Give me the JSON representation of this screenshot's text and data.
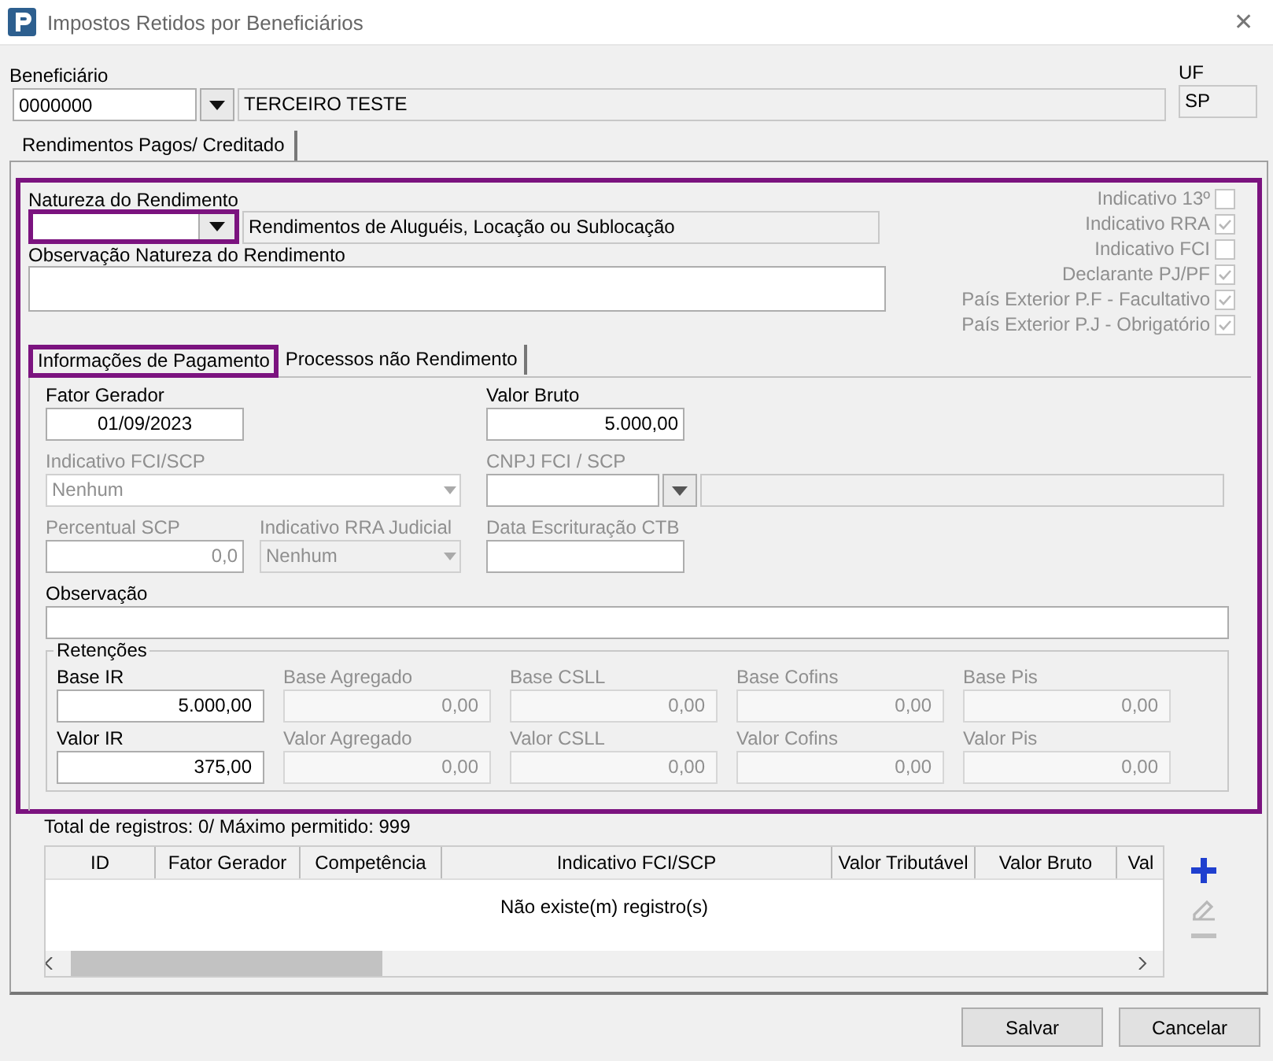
{
  "window": {
    "title": "Impostos Retidos por Beneficiários",
    "close": "✕"
  },
  "beneficiario": {
    "label": "Beneficiário",
    "code": "0000000",
    "name": "TERCEIRO TESTE",
    "uf_label": "UF",
    "uf": "SP"
  },
  "tabs": [
    {
      "label": "Rendimentos Pagos/ Creditado",
      "selected": true
    }
  ],
  "natureza": {
    "label": "Natureza do Rendimento",
    "description": "Rendimentos de Aluguéis, Locação ou Sublocação"
  },
  "observacao_natureza": {
    "label": "Observação Natureza do Rendimento"
  },
  "checkboxes": [
    {
      "label": "Indicativo 13º",
      "checked": false,
      "disabled": true
    },
    {
      "label": "Indicativo RRA",
      "checked": true,
      "disabled": true
    },
    {
      "label": "Indicativo FCI",
      "checked": false,
      "disabled": true
    },
    {
      "label": "Declarante PJ/PF",
      "checked": true,
      "disabled": true
    },
    {
      "label": "País Exterior P.F - Facultativo",
      "checked": true,
      "disabled": true
    },
    {
      "label": "País Exterior P.J - Obrigatório",
      "checked": true,
      "disabled": true
    }
  ],
  "subtabs": [
    {
      "label": "Informações de Pagamento",
      "selected": true
    },
    {
      "label": "Processos não Rendimento",
      "selected": false
    }
  ],
  "payment": {
    "fator_gerador": {
      "label": "Fator Gerador",
      "value": "01/09/2023",
      "disabled": false
    },
    "valor_bruto": {
      "label": "Valor Bruto",
      "value": "5.000,00",
      "disabled": false
    },
    "indicativo_fci": {
      "label": "Indicativo FCI/SCP",
      "value": "Nenhum",
      "disabled": true
    },
    "cnpj_fci": {
      "label": "CNPJ FCI / SCP",
      "disabled": true
    },
    "percentual_scp": {
      "label": "Percentual SCP",
      "value": "0,0",
      "disabled": true
    },
    "indicativo_rra": {
      "label": "Indicativo RRA Judicial",
      "value": "Nenhum",
      "disabled": true
    },
    "data_escrituracao": {
      "label": "Data Escrituração CTB",
      "disabled": true
    },
    "observacao": {
      "label": "Observação",
      "disabled": false
    }
  },
  "retencoes": {
    "title": "Retenções",
    "rows": [
      [
        {
          "label": "Base IR",
          "value": "5.000,00",
          "disabled": false
        },
        {
          "label": "Base Agregado",
          "value": "0,00",
          "disabled": true
        },
        {
          "label": "Base CSLL",
          "value": "0,00",
          "disabled": true
        },
        {
          "label": "Base Cofins",
          "value": "0,00",
          "disabled": true
        },
        {
          "label": "Base Pis",
          "value": "0,00",
          "disabled": true
        }
      ],
      [
        {
          "label": "Valor IR",
          "value": "375,00",
          "disabled": false
        },
        {
          "label": "Valor Agregado",
          "value": "0,00",
          "disabled": true
        },
        {
          "label": "Valor CSLL",
          "value": "0,00",
          "disabled": true
        },
        {
          "label": "Valor Cofins",
          "value": "0,00",
          "disabled": true
        },
        {
          "label": "Valor Pis",
          "value": "0,00",
          "disabled": true
        }
      ]
    ]
  },
  "records": {
    "summary": "Total de registros: 0/ Máximo permitido: 999",
    "columns": [
      "ID",
      "Fator Gerador",
      "Competência",
      "Indicativo FCI/SCP",
      "Valor Tributável",
      "Valor Bruto",
      "Val"
    ],
    "empty": "Não existe(m) registro(s)"
  },
  "row_actions": [
    {
      "kind": "add",
      "disabled": false
    },
    {
      "kind": "edit",
      "disabled": true
    },
    {
      "kind": "remove",
      "disabled": true
    }
  ],
  "buttons": [
    {
      "label": "Salvar"
    },
    {
      "label": "Cancelar"
    }
  ]
}
